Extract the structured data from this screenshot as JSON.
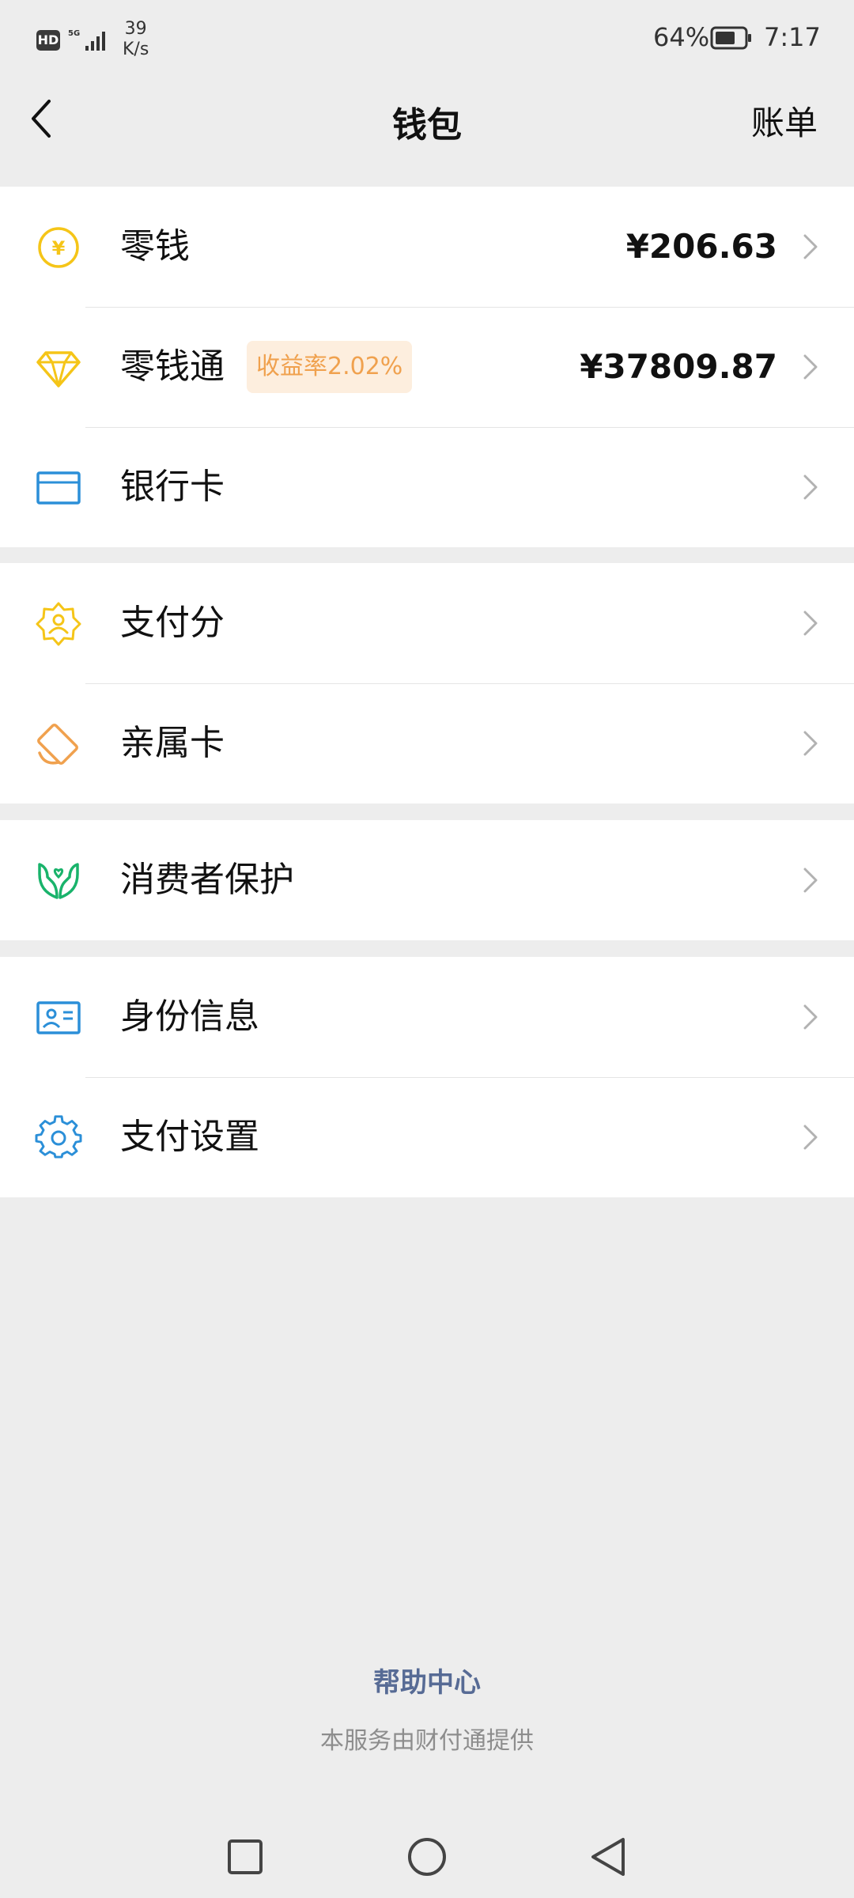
{
  "status_bar": {
    "hd": "HD",
    "network": "5G",
    "speed_value": "39",
    "speed_unit": "K/s",
    "battery": "64%",
    "time": "7:17"
  },
  "nav": {
    "title": "钱包",
    "right_label": "账单"
  },
  "groups": [
    [
      {
        "label": "零钱",
        "icon": "yuan-coin-icon",
        "amount": "¥206.63"
      },
      {
        "label": "零钱通",
        "icon": "diamond-icon",
        "badge": "收益率2.02%",
        "amount": "¥37809.87"
      },
      {
        "label": "银行卡",
        "icon": "bank-card-icon"
      }
    ],
    [
      {
        "label": "支付分",
        "icon": "pay-score-badge-icon"
      },
      {
        "label": "亲属卡",
        "icon": "family-card-icon"
      }
    ],
    [
      {
        "label": "消费者保护",
        "icon": "protect-hands-icon"
      }
    ],
    [
      {
        "label": "身份信息",
        "icon": "id-card-icon"
      },
      {
        "label": "支付设置",
        "icon": "gear-icon"
      }
    ]
  ],
  "footer": {
    "help": "帮助中心",
    "provider": "本服务由财付通提供"
  },
  "colors": {
    "background": "#ededed",
    "yellow": "#f5c518",
    "orange": "#f0a14e",
    "blue": "#2b8fd8",
    "green": "#19b36b",
    "link": "#576b95"
  }
}
